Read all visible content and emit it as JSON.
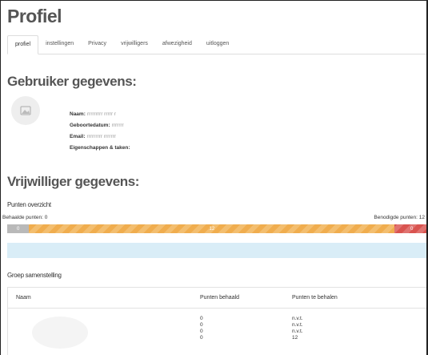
{
  "page": {
    "title": "Profiel"
  },
  "tabs": [
    {
      "label": "profiel",
      "active": true
    },
    {
      "label": "instellingen",
      "active": false
    },
    {
      "label": "Privacy",
      "active": false
    },
    {
      "label": "vrijwilligers",
      "active": false
    },
    {
      "label": "afwezigheid",
      "active": false
    },
    {
      "label": "uitloggen",
      "active": false
    }
  ],
  "user": {
    "heading": "Gebruiker gegevens:",
    "name_label": "Naam:",
    "name_value": "rrrrrrrrr rrrrr r",
    "birth_label": "Geboortedatum:",
    "birth_value": "rrrrrrr",
    "email_label": "Email:",
    "email_value": "rrrrrrrrr rrrrrrr",
    "traits_label": "Eigenschappen & taken:"
  },
  "volunteer": {
    "heading": "Vrijwilliger gegevens:",
    "points_overview": "Punten overzicht",
    "earned_label": "Behaalde punten: 0",
    "needed_label": "Benodigde punten: 12",
    "progress": {
      "segments": [
        {
          "value": 0,
          "fraction": 0.052,
          "color": "#b9b9b9"
        },
        {
          "value": 12,
          "fraction": 0.867,
          "color": "#f0ad4e"
        },
        {
          "value": 0,
          "fraction": 0.081,
          "color": "#d9534f"
        }
      ]
    }
  },
  "group": {
    "heading": "Groep samenstelling",
    "columns": [
      "Naam",
      "Punten behaald",
      "Punten te behalen"
    ],
    "earned": [
      "0",
      "0",
      "0",
      "0"
    ],
    "to_earn": [
      "n.v.t.",
      "n.v.t.",
      "n.v.t.",
      "12"
    ]
  }
}
